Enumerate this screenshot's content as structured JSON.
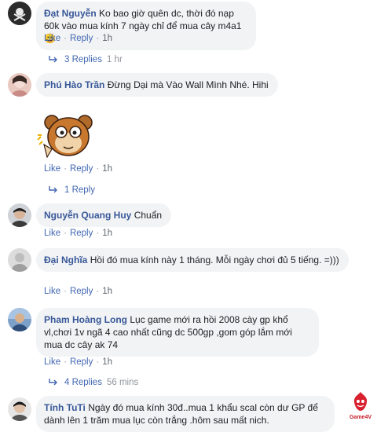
{
  "comments": [
    {
      "author": "Đạt Nguyễn",
      "text": "Ko bao giờ quên dc, thời đó nạp 60k vào mua kính 7 ngày chỉ để mua cây m4a1",
      "emoji": "😀",
      "like": "Like",
      "reply": "Reply",
      "time": "1h",
      "replies_label": "3 Replies",
      "replies_time": "1 hr"
    },
    {
      "author": "Phú Hào Trần",
      "text": "Đừng Dại mà Vào Wall Mình Nhé. Hihi",
      "like": "Like",
      "reply": "Reply",
      "time": "1h",
      "replies_label": "1 Reply"
    },
    {
      "author": "Nguyễn Quang Huy",
      "text": "Chuẩn",
      "like": "Like",
      "reply": "Reply",
      "time": "1h"
    },
    {
      "author": "Đại Nghĩa",
      "text": "Hồi đó mua kính này 1 tháng. Mỗi ngày chơi đủ 5 tiếng. =)))",
      "like": "Like",
      "reply": "Reply",
      "time": "1h"
    },
    {
      "author": "Pham Hoàng Long",
      "text": "Lục game mới ra hồi 2008 cày gp khổ vl,chơi 1v ngã 4 cao nhất cũng dc 500gp ,gom góp lắm mới mua dc cây ak 74",
      "like": "Like",
      "reply": "Reply",
      "time": "1h",
      "replies_label": "4 Replies",
      "replies_time": "56 mins"
    },
    {
      "author": "Tính TuTi",
      "text": "Ngày đó mua kính 30đ..mua 1 khẩu scal còn dư GP để dành lên 1 trăm mua lục còn trắng .hôm sau mất nich."
    }
  ],
  "watermark": "Game4V",
  "colors": {
    "name": "#385898",
    "link": "#4267b2",
    "bubble": "#f2f3f5",
    "meta": "#90949c"
  }
}
